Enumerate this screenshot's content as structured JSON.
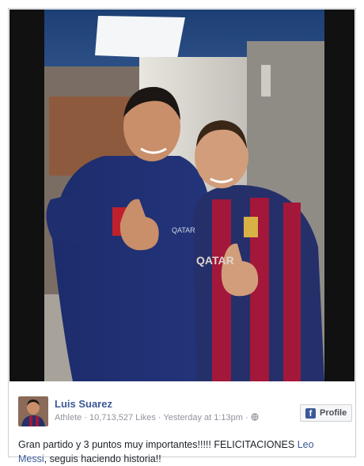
{
  "post": {
    "author_name": "Luis Suarez",
    "category": "Athlete",
    "likes": "10,713,527 Likes",
    "time": "Yesterday at 1:13pm",
    "separator": "·",
    "profile_button": "Profile",
    "fb_logo": "f",
    "text_before": "Gran partido y 3 puntos muy importantes!!!!! FELICITACIONES ",
    "mention_first": "Leo",
    "mention_second": "Messi",
    "text_after": ", seguis haciendo historia!!",
    "crest_sponsor": "QATAR",
    "shirt_sponsor": "QATAR"
  },
  "icons": {
    "privacy": "globe-icon",
    "profile": "facebook-f-icon"
  },
  "colors": {
    "link": "#3b5998",
    "meta": "#90949c",
    "text": "#1d2129"
  }
}
